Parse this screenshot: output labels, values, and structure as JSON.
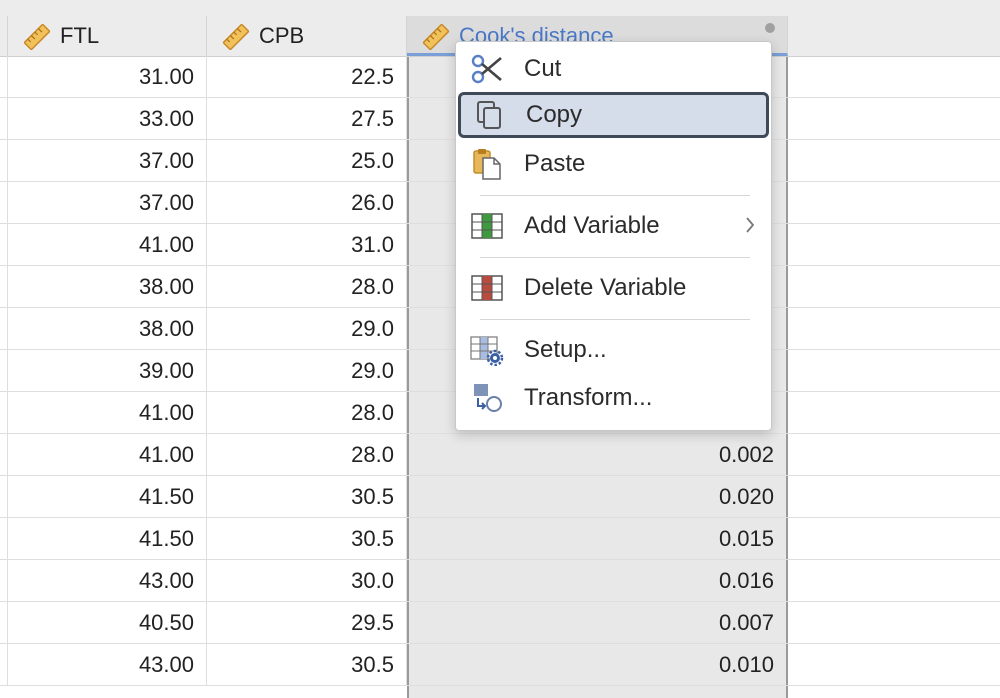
{
  "columns": [
    {
      "name": "FTL",
      "icon": "ruler-icon"
    },
    {
      "name": "CPB",
      "icon": "ruler-icon"
    },
    {
      "name": "Cook's distance",
      "icon": "ruler-icon",
      "selected": true
    }
  ],
  "rows": [
    [
      "31.00",
      "22.5",
      ""
    ],
    [
      "33.00",
      "27.5",
      ""
    ],
    [
      "37.00",
      "25.0",
      ""
    ],
    [
      "37.00",
      "26.0",
      ""
    ],
    [
      "41.00",
      "31.0",
      ""
    ],
    [
      "38.00",
      "28.0",
      ""
    ],
    [
      "38.00",
      "29.0",
      ""
    ],
    [
      "39.00",
      "29.0",
      ""
    ],
    [
      "41.00",
      "28.0",
      ""
    ],
    [
      "41.00",
      "28.0",
      "0.002"
    ],
    [
      "41.50",
      "30.5",
      "0.020"
    ],
    [
      "41.50",
      "30.5",
      "0.015"
    ],
    [
      "43.00",
      "30.0",
      "0.016"
    ],
    [
      "40.50",
      "29.5",
      "0.007"
    ],
    [
      "43.00",
      "30.5",
      "0.010"
    ]
  ],
  "context_menu": {
    "cut": {
      "label": "Cut",
      "icon": "scissors-icon"
    },
    "copy": {
      "label": "Copy",
      "icon": "copy-icon",
      "highlighted": true
    },
    "paste": {
      "label": "Paste",
      "icon": "paste-icon"
    },
    "add_variable": {
      "label": "Add Variable",
      "icon": "add-variable-icon",
      "submenu": true
    },
    "delete_variable": {
      "label": "Delete Variable",
      "icon": "delete-variable-icon"
    },
    "setup": {
      "label": "Setup...",
      "icon": "setup-gear-icon"
    },
    "transform": {
      "label": "Transform...",
      "icon": "transform-icon"
    }
  },
  "colors": {
    "header_bg": "#ececec",
    "selected_header_text": "#4a78c7",
    "selected_column_bg": "#e8e8e8",
    "menu_highlight_bg": "#d5dcea",
    "menu_highlight_border": "#3f4a59",
    "ruler_icon": "#e3a93a",
    "add_column_green": "#3f9a3f",
    "delete_column_red": "#b84a3e"
  }
}
